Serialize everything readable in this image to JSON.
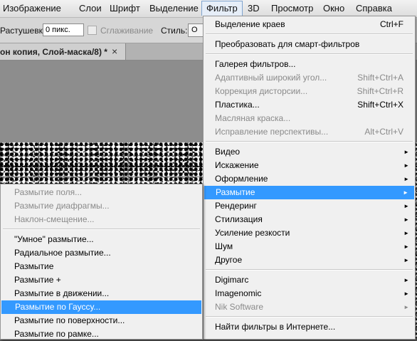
{
  "menubar": {
    "items": [
      "Изображение",
      "Слои",
      "Шрифт",
      "Выделение",
      "Фильтр",
      "3D",
      "Просмотр",
      "Окно",
      "Справка"
    ]
  },
  "options": {
    "feather_label": "Растушевка:",
    "feather_value": "0 пикс.",
    "antialias_label": "Сглаживание",
    "style_label": "Стиль:",
    "style_value": "О"
  },
  "document": {
    "tab_title": "он копия, Слой-маска/8) *",
    "close_glyph": "×"
  },
  "filter_menu": {
    "items": [
      {
        "label": "Выделение краев",
        "shortcut": "Ctrl+F",
        "disabled": false,
        "submenu": false,
        "highlight": false
      },
      {
        "label": "Преобразовать для смарт-фильтров",
        "shortcut": "",
        "disabled": false,
        "submenu": false,
        "highlight": false
      },
      {
        "label": "Галерея фильтров...",
        "shortcut": "",
        "disabled": false,
        "submenu": false,
        "highlight": false
      },
      {
        "label": "Адаптивный широкий угол...",
        "shortcut": "Shift+Ctrl+A",
        "disabled": true,
        "submenu": false,
        "highlight": false
      },
      {
        "label": "Коррекция дисторсии...",
        "shortcut": "Shift+Ctrl+R",
        "disabled": true,
        "submenu": false,
        "highlight": false
      },
      {
        "label": "Пластика...",
        "shortcut": "Shift+Ctrl+X",
        "disabled": false,
        "submenu": false,
        "highlight": false
      },
      {
        "label": "Масляная краска...",
        "shortcut": "",
        "disabled": true,
        "submenu": false,
        "highlight": false
      },
      {
        "label": "Исправление перспективы...",
        "shortcut": "Alt+Ctrl+V",
        "disabled": true,
        "submenu": false,
        "highlight": false
      },
      {
        "label": "Видео",
        "shortcut": "",
        "disabled": false,
        "submenu": true,
        "highlight": false
      },
      {
        "label": "Искажение",
        "shortcut": "",
        "disabled": false,
        "submenu": true,
        "highlight": false
      },
      {
        "label": "Оформление",
        "shortcut": "",
        "disabled": false,
        "submenu": true,
        "highlight": false
      },
      {
        "label": "Размытие",
        "shortcut": "",
        "disabled": false,
        "submenu": true,
        "highlight": true
      },
      {
        "label": "Рендеринг",
        "shortcut": "",
        "disabled": false,
        "submenu": true,
        "highlight": false
      },
      {
        "label": "Стилизация",
        "shortcut": "",
        "disabled": false,
        "submenu": true,
        "highlight": false
      },
      {
        "label": "Усиление резкости",
        "shortcut": "",
        "disabled": false,
        "submenu": true,
        "highlight": false
      },
      {
        "label": "Шум",
        "shortcut": "",
        "disabled": false,
        "submenu": true,
        "highlight": false
      },
      {
        "label": "Другое",
        "shortcut": "",
        "disabled": false,
        "submenu": true,
        "highlight": false
      },
      {
        "label": "Digimarc",
        "shortcut": "",
        "disabled": false,
        "submenu": true,
        "highlight": false
      },
      {
        "label": "Imagenomic",
        "shortcut": "",
        "disabled": false,
        "submenu": true,
        "highlight": false
      },
      {
        "label": "Nik Software",
        "shortcut": "",
        "disabled": true,
        "submenu": true,
        "highlight": false
      },
      {
        "label": "Найти фильтры в Интернете...",
        "shortcut": "",
        "disabled": false,
        "submenu": false,
        "highlight": false
      }
    ]
  },
  "blur_submenu": {
    "items": [
      {
        "label": "Размытие поля...",
        "disabled": true,
        "highlight": false
      },
      {
        "label": "Размытие диафрагмы...",
        "disabled": true,
        "highlight": false
      },
      {
        "label": "Наклон-смещение...",
        "disabled": true,
        "highlight": false
      },
      {
        "label": "\"Умное\" размытие...",
        "disabled": false,
        "highlight": false
      },
      {
        "label": "Радиальное размытие...",
        "disabled": false,
        "highlight": false
      },
      {
        "label": "Размытие",
        "disabled": false,
        "highlight": false
      },
      {
        "label": "Размытие +",
        "disabled": false,
        "highlight": false
      },
      {
        "label": "Размытие в движении...",
        "disabled": false,
        "highlight": false
      },
      {
        "label": "Размытие по Гауссу...",
        "disabled": false,
        "highlight": true
      },
      {
        "label": "Размытие по поверхности...",
        "disabled": false,
        "highlight": false
      },
      {
        "label": "Размытие по рамке...",
        "disabled": false,
        "highlight": false
      }
    ]
  },
  "icons": {
    "submenu_arrow": "►"
  }
}
